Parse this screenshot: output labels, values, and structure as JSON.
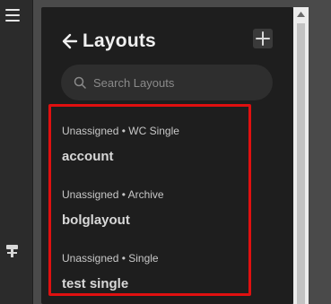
{
  "panel": {
    "title": "Layouts",
    "back_icon": "arrow-left-icon",
    "add_icon": "plus-icon"
  },
  "search": {
    "placeholder": "Search Layouts",
    "value": ""
  },
  "layouts": [
    {
      "meta": "Unassigned • WC Single",
      "name": "account"
    },
    {
      "meta": "Unassigned • Archive",
      "name": "bolglayout"
    },
    {
      "meta": "Unassigned • Single",
      "name": "test single"
    }
  ],
  "colors": {
    "panel_bg": "#1e1e1e",
    "highlight_border": "#e01010",
    "title_text": "#f0f0f0"
  }
}
